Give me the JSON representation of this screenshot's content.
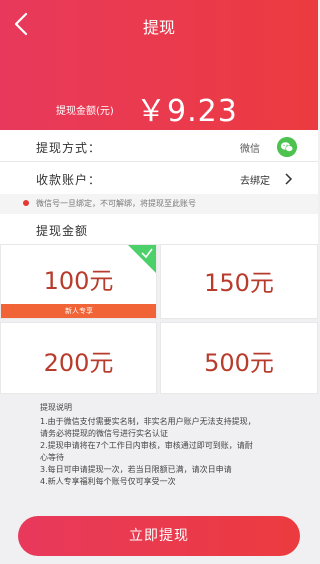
{
  "header": {
    "title": "提现",
    "balance_label": "提现金额(元)",
    "balance_value": "￥9.23",
    "accent": "#ea3a4e"
  },
  "method": {
    "label": "提现方式：",
    "value": "微信",
    "icon": "wechat-icon"
  },
  "account": {
    "label": "收款账户：",
    "value": "去绑定"
  },
  "note": {
    "text": "微信号一旦绑定，不可解绑，将提现至此账号"
  },
  "amount": {
    "label": "提现金额",
    "options": [
      {
        "label": "100元",
        "selected": true,
        "badge": "新人专享"
      },
      {
        "label": "150元",
        "selected": false
      },
      {
        "label": "200元",
        "selected": false
      },
      {
        "label": "500元",
        "selected": false
      }
    ]
  },
  "info": {
    "title": "提现说明",
    "lines": [
      "1.由于微信支付需要实名制，非实名用户账户无法支持提现，",
      "请务必将提现的微信号进行实名认证",
      "2.提现申请将在7个工作日内审核，审核通过即可到账，请耐",
      "心等待",
      "3.每日可申请提现一次，若当日限额已满，请次日申请",
      "4.新人专享福利每个账号仅可享受一次"
    ]
  },
  "submit": {
    "label": "立即提现"
  }
}
